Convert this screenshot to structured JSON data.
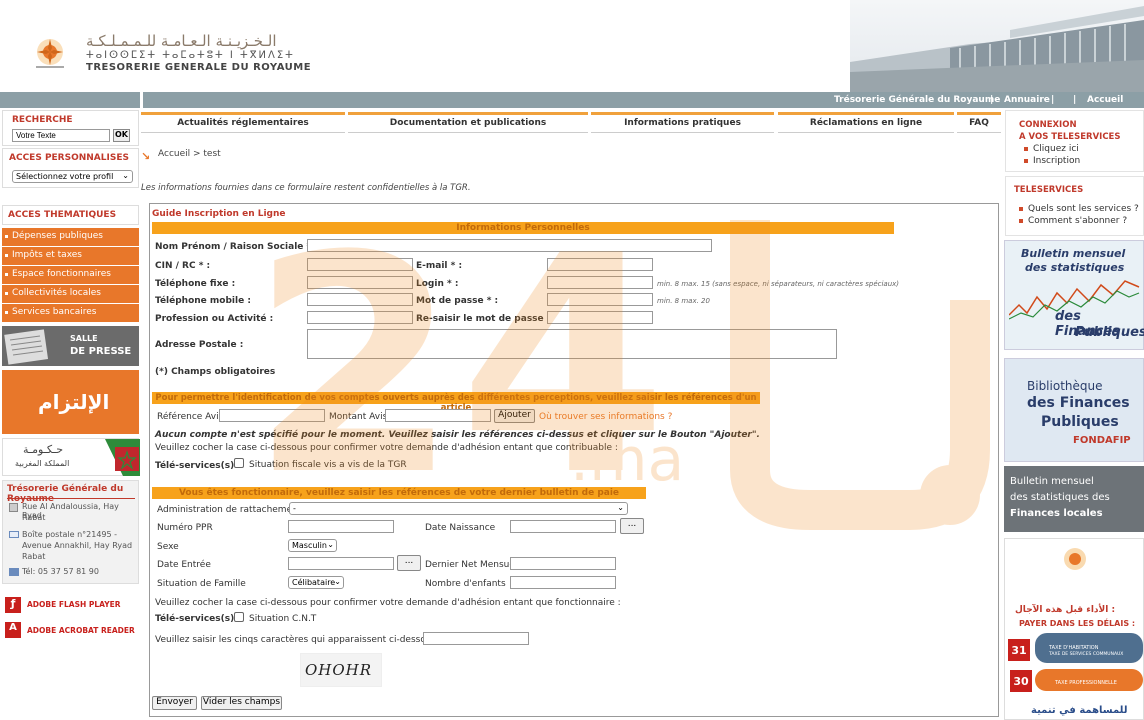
{
  "header": {
    "logo_ar": "الـخـزيـنـة الـعـامـة للـمـمـلـكـة",
    "logo_tif": "ⵜⴰⵏⵙⵙⵎⵉⵜ ⵜⴰⵎⴰⵜⵓⵜ ⵏ ⵜⴳⵍⴷⵉⵜ",
    "logo_fr": "TRESORERIE GENERALE DU ROYAUME"
  },
  "topbar": {
    "tgr": "Trésorerie Générale du Royaume",
    "sep1": "|",
    "annuaire": "Annuaire",
    "sep2": "|",
    "sep3": "|",
    "accueil": "Accueil"
  },
  "left": {
    "recherche": "RECHERCHE",
    "search_value": "Votre Texte",
    "ok": "OK",
    "acces_perso": "ACCES PERSONNALISES",
    "profil": "Sélectionnez votre profil",
    "acces_them": "ACCES THEMATIQUES",
    "items": [
      "Dépenses publiques",
      "Impôts et taxes",
      "Espace fonctionnaires",
      "Collectivités locales",
      "Services bancaires"
    ],
    "salle1": "SALLE",
    "salle2": "DE PRESSE",
    "iltizam": "الإلتزام",
    "gov_ar": "حـكـومـة",
    "gov_ar2": "المملكة المغربية",
    "tgr_title": "Trésorerie Générale du Royaume",
    "addr1": "Rue Al Andaloussia, Hay Ryad",
    "addr2": "Rabat",
    "bp1": "Boîte postale n°21495 -",
    "bp2": "Avenue Annakhil, Hay Ryad",
    "bp3": "Rabat",
    "tel": "Tél: 05 37 57 81 90",
    "flash": "ADOBE FLASH PLAYER",
    "acrobat": "ADOBE ACROBAT READER"
  },
  "nav": [
    "Actualités réglementaires",
    "Documentation et publications",
    "Informations pratiques",
    "Réclamations en ligne",
    "FAQ"
  ],
  "breadcrumb": "Accueil > test",
  "confidential": "Les informations fournies dans ce formulaire restent confidentielles à la TGR.",
  "form": {
    "title": "Guide Inscription en Ligne",
    "section1": "Informations Personnelles",
    "nom": "Nom Prénom / Raison Sociale * :",
    "cin": "CIN / RC * :",
    "email": "E-mail * :",
    "tel_fixe": "Téléphone fixe :",
    "login": "Login * :",
    "login_hint": "min. 8 max. 15 (sans espace, ni séparateurs, ni caractères spéciaux)",
    "tel_mobile": "Téléphone mobile :",
    "mdp": "Mot de passe * :",
    "mdp_hint": "min. 8 max. 20",
    "profession": "Profession ou Activité :",
    "remdp": "Re-saisir le mot de passe * :",
    "adresse": "Adresse Postale :",
    "obligatoire": "(*) Champs obligatoires",
    "section2": "Pour permettre l'identification de vos comptes ouverts auprès des différentes perceptions, veuillez saisir les références d'un article",
    "ref_avis": "Référence Avis",
    "montant_avis": "Montant Avis",
    "ajouter": "Ajouter",
    "ou_trouver": "Où trouver ses informations ?",
    "aucun": "Aucun compte n'est spécifié pour le moment. Veuillez saisir les références ci-dessus et cliquer sur le Bouton \"Ajouter\".",
    "cocher1": "Veuillez cocher la case ci-dessous pour confirmer votre demande d'adhésion entant que contribuable :",
    "teleservices": "Télé-services(s)",
    "situation_fiscale": "Situation fiscale vis a vis de la TGR",
    "section3": "Vous êtes fonctionnaire, veuillez saisir les références de votre dernier bulletin de paie",
    "admin": "Administration de rattachement",
    "admin_value": "-",
    "ppr": "Numéro PPR",
    "date_naissance": "Date Naissance",
    "dots": "...",
    "sexe": "Sexe",
    "sexe_value": "Masculin",
    "date_entree": "Date Entrée",
    "dernier_net": "Dernier Net Mensuel",
    "situation_famille": "Situation de Famille",
    "famille_value": "Célibataire",
    "nombre_enfants": "Nombre d'enfants",
    "cocher2": "Veuillez cocher la case ci-dessous pour confirmer votre demande d'adhésion entant que fonctionnaire :",
    "teleservices2": "Télé-services(s)",
    "situation_cnt": "Situation C.N.T",
    "captcha_label": "Veuillez saisir les cinqs caractères qui apparaissent ci-dessous * :",
    "captcha": "OHOHR",
    "envoyer": "Envoyer",
    "vider": "Vider les champs"
  },
  "right": {
    "connexion1": "CONNEXION",
    "connexion2": "A VOS TELESERVICES",
    "cliquez": "Cliquez ici",
    "inscription": "Inscription",
    "teleservices": "TELESERVICES",
    "quels": "Quels sont les services ?",
    "comment": "Comment s'abonner ?",
    "bull1a": "Bulletin mensuel",
    "bull1b": "des statistiques",
    "bull1c": "des Finances",
    "bull1d": "Publiques",
    "bib1": "Bibliothèque",
    "bib2": "des Finances",
    "bib3": "Publiques",
    "fondafip": "FONDAFIP",
    "bull2a": "Bulletin mensuel",
    "bull2b": "des statistiques des",
    "bull2c": "Finances locales",
    "delai_ar": "الأداء قبل هذه الآجال :",
    "payer": "PAYER DANS LES DÉLAIS :",
    "taxe1": "TAXE D'HABITATION",
    "taxe1b": "TAXE DE SERVICES COMMUNAUX",
    "taxe2": "TAXE PROFESSIONNELLE",
    "n31": "31",
    "n30": "30",
    "bottom_ar": "للمساهمة في تنمية"
  },
  "watermark": {
    "text": "24",
    "ma": ".ma"
  },
  "colors": {
    "orange": "#e8772a",
    "bar": "#f7a21b",
    "topbar": "#8c9fa6",
    "red": "#c0392b"
  }
}
